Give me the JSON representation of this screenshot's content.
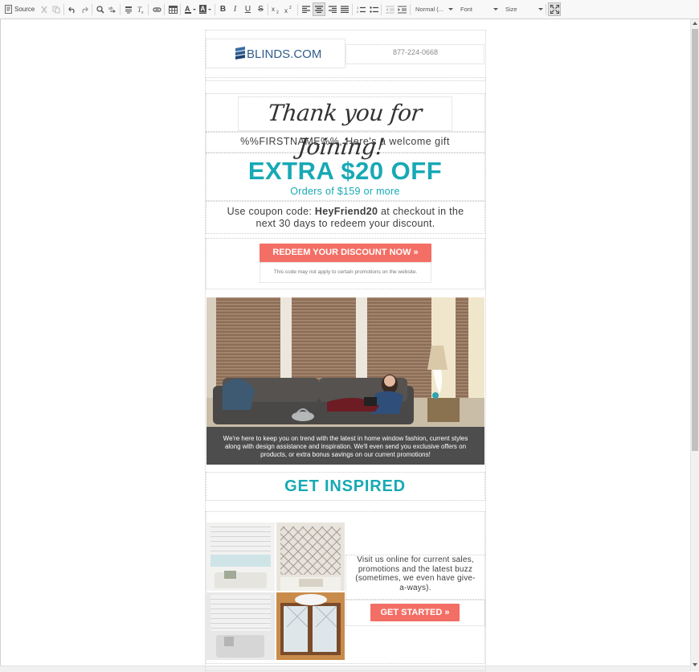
{
  "toolbar": {
    "source_label": "Source",
    "format_label": "Normal (...",
    "font_label": "Font",
    "size_label": "Size"
  },
  "email": {
    "logo_text": "BLINDS.COM",
    "phone": "877-224-0668",
    "thank_you": "Thank you for Joining!",
    "greeting": "%%FIRSTNAME%%, Here's a welcome gift",
    "offer_headline": "EXTRA $20 OFF",
    "offer_sub": "Orders of $159 or more",
    "coupon_prefix": "Use coupon code: ",
    "coupon_code": "HeyFriend20",
    "coupon_suffix": " at checkout in the next 30 days to redeem your discount.",
    "redeem_button": "REDEEM YOUR DISCOUNT NOW »",
    "disclaimer": "This code may not apply to certain promotions on the website.",
    "hero_caption": "We're here to keep you on trend with the latest in home window fashion, current styles along with design assistance and inspiration. We'll even send you exclusive offers on products, or extra bonus savings on our current promotions!",
    "inspired_heading": "GET INSPIRED",
    "visit_text": "Visit us online for current sales, promotions and the latest buzz (sometimes, we even have give-a-ways).",
    "started_button": "GET STARTED »"
  },
  "colors": {
    "accent_teal": "#17a9b5",
    "button_coral": "#f36f65",
    "caption_bg": "#4d4d4d"
  }
}
